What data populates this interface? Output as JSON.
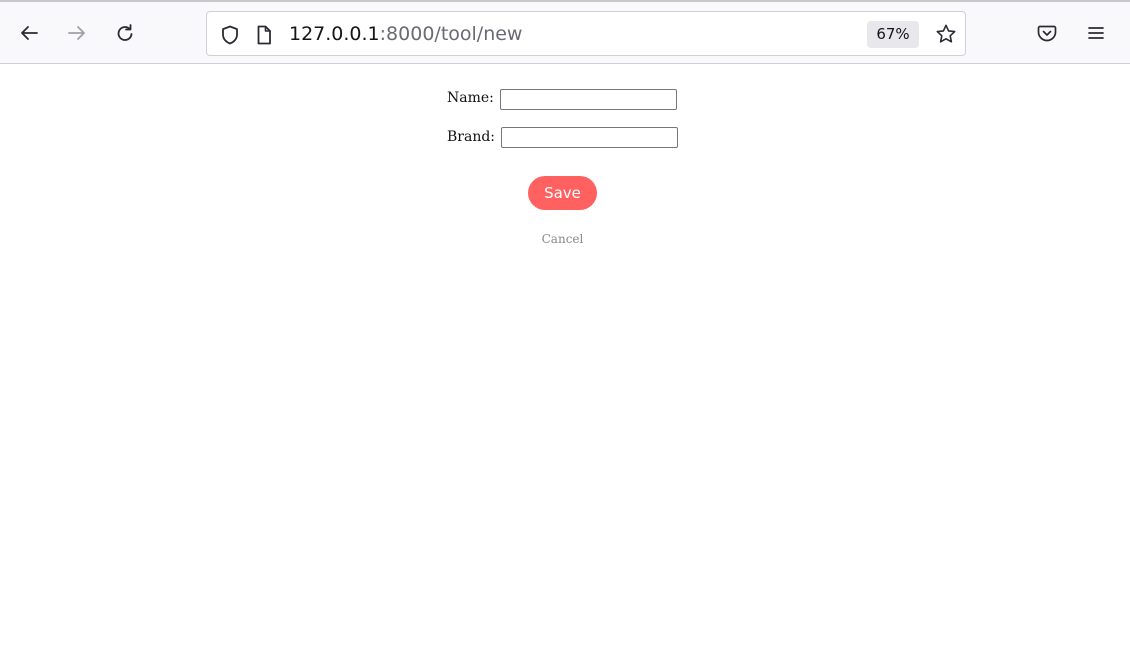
{
  "browser": {
    "url_host": "127.0.0.1",
    "url_path": ":8000/tool/new",
    "zoom": "67%",
    "colors": {
      "toolbar_bg": "#f9f9fb",
      "icon": "#2b2a33",
      "icon_disabled": "#a0a0a8"
    },
    "icons": [
      "back-arrow-icon",
      "forward-arrow-icon",
      "reload-icon",
      "shield-icon",
      "page-icon",
      "star-icon",
      "pocket-icon",
      "menu-icon"
    ]
  },
  "form": {
    "name_label": "Name:",
    "name_value": "",
    "brand_label": "Brand:",
    "brand_value": "",
    "save_label": "Save",
    "cancel_label": "Cancel",
    "colors": {
      "save_bg": "#ff6060",
      "save_text": "#ffffff",
      "cancel_text": "#8a8a8a"
    }
  }
}
